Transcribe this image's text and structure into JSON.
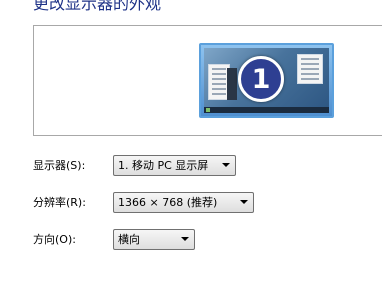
{
  "page": {
    "title": "更改显示器的外观"
  },
  "preview": {
    "monitor_number": "1"
  },
  "settings": {
    "display": {
      "label": "显示器(S):",
      "value": "1. 移动 PC 显示屏"
    },
    "resolution": {
      "label": "分辨率(R):",
      "value": "1366 × 768 (推荐)"
    },
    "orientation": {
      "label": "方向(O):",
      "value": "横向"
    }
  }
}
